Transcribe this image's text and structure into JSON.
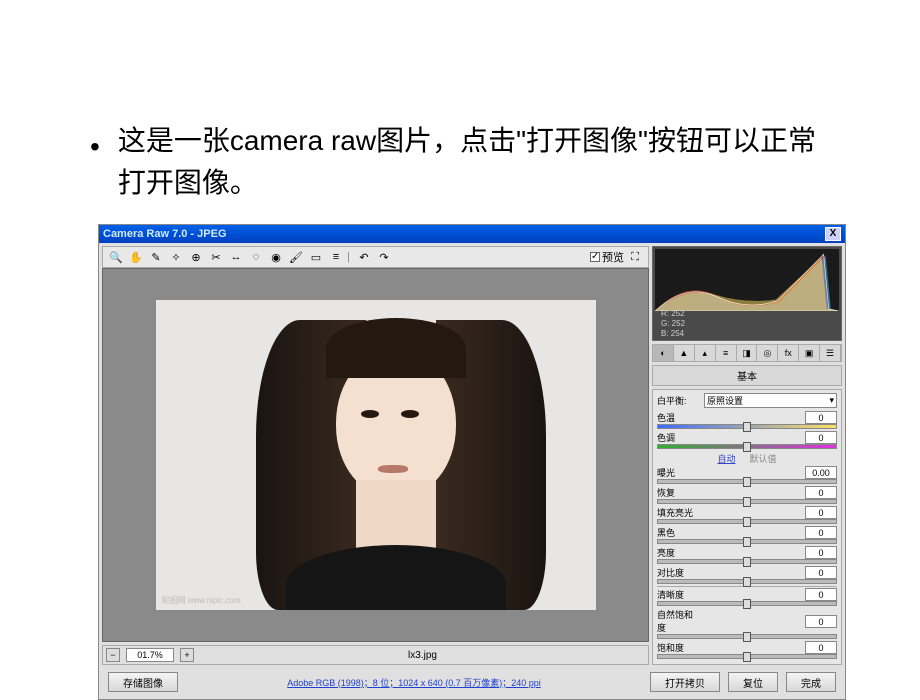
{
  "slide": {
    "bullet": "这是一张camera raw图片，点击\"打开图像\"按钮可以正常打开图像。"
  },
  "titlebar": {
    "title": "Camera Raw 7.0 - JPEG",
    "close": "X"
  },
  "toolbar": {
    "preview_label": "预览",
    "icons": [
      "zoom",
      "hand",
      "eyedrop",
      "sampler",
      "target",
      "crop",
      "straighten",
      "spot",
      "redeye",
      "brush",
      "grad",
      "prefs",
      "rotate-l",
      "rotate-r"
    ]
  },
  "rgb": {
    "r": "R: 252",
    "g": "G: 252",
    "b": "B: 254"
  },
  "panel": {
    "title": "基本",
    "wb_label": "白平衡:",
    "wb_value": "原照设置",
    "auto": "自动",
    "default": "默认值",
    "sliders": [
      {
        "label": "色温",
        "val": "0",
        "gradient": "temp"
      },
      {
        "label": "色调",
        "val": "0",
        "gradient": "tint"
      },
      {
        "label": "曝光",
        "val": "0.00"
      },
      {
        "label": "恢复",
        "val": "0"
      },
      {
        "label": "填充亮光",
        "val": "0"
      },
      {
        "label": "黑色",
        "val": "0"
      },
      {
        "label": "亮度",
        "val": "0"
      },
      {
        "label": "对比度",
        "val": "0"
      },
      {
        "label": "清晰度",
        "val": "0"
      },
      {
        "label": "自然饱和度",
        "val": "0"
      },
      {
        "label": "饱和度",
        "val": "0"
      }
    ]
  },
  "statusbar": {
    "zoom": "01.7%",
    "filename": "lx3.jpg"
  },
  "footer": {
    "save_image": "存储图像",
    "info": "Adobe RGB (1998)；8 位；1024 x 640 (0.7 百万像素)；240 ppi",
    "open_copy": "打开拷贝",
    "reset": "复位",
    "done": "完成"
  },
  "watermark": "昵图网 www.nipic.com"
}
